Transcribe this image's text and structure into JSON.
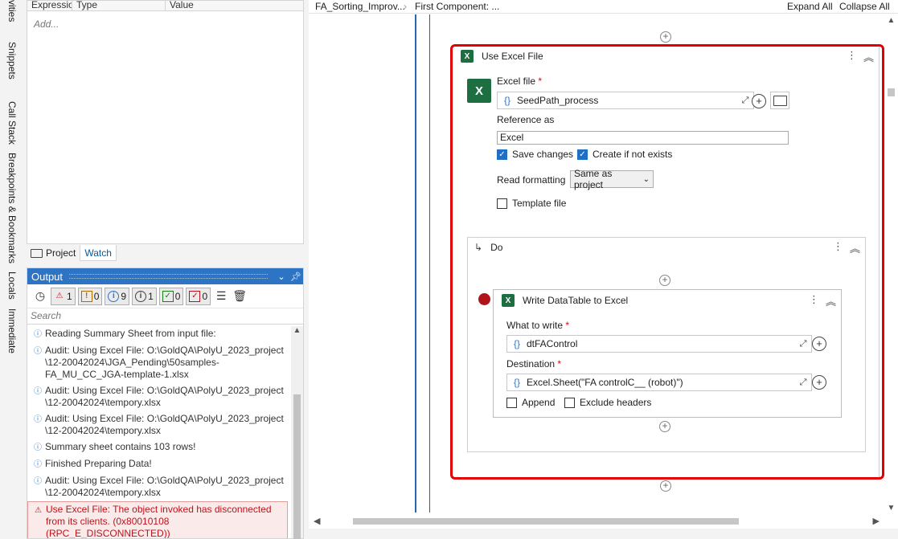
{
  "left_strip": {
    "tabs": [
      "Activities",
      "Snippets",
      "Call Stack",
      "Breakpoints & Bookmarks",
      "Locals",
      "Immediate"
    ]
  },
  "properties": {
    "columns": [
      "Expression",
      "Type",
      "Value"
    ],
    "add_placeholder": "Add..."
  },
  "panel_tabs": {
    "project": "Project",
    "watch": "Watch"
  },
  "output": {
    "title": "Output",
    "counts": {
      "errors": "1",
      "warnings": "0",
      "info": "9",
      "trace": "1",
      "success": "0",
      "verify": "0"
    },
    "search_placeholder": "Search",
    "logs": [
      {
        "text": "Reading Summary Sheet from input file:",
        "type": "info"
      },
      {
        "text": "Audit: Using Excel File: O:\\GoldQA\\PolyU_2023_project \\12-20042024\\JGA_Pending\\50samples-FA_MU_CC_JGA-template-1.xlsx",
        "type": "info"
      },
      {
        "text": "Audit: Using Excel File: O:\\GoldQA\\PolyU_2023_project \\12-20042024\\tempory.xlsx",
        "type": "info"
      },
      {
        "text": "Audit: Using Excel File: O:\\GoldQA\\PolyU_2023_project \\12-20042024\\tempory.xlsx",
        "type": "info"
      },
      {
        "text": "Summary sheet contains 103 rows!",
        "type": "info"
      },
      {
        "text": "Finished Preparing Data!",
        "type": "info"
      },
      {
        "text": "Audit: Using Excel File: O:\\GoldQA\\PolyU_2023_project \\12-20042024\\tempory.xlsx",
        "type": "info"
      },
      {
        "text": "Use Excel File: The object invoked has disconnected from its clients. (0x80010108 (RPC_E_DISCONNECTED))",
        "type": "error"
      }
    ]
  },
  "breadcrumb": {
    "items": [
      "FA_Sorting_Improv...",
      "First Component: ..."
    ],
    "expand_all": "Expand All",
    "collapse_all": "Collapse All"
  },
  "use_excel": {
    "title": "Use Excel File",
    "excel_file_label": "Excel file",
    "excel_file_value": "SeedPath_process",
    "reference_label": "Reference as",
    "reference_value": "Excel",
    "save_changes": "Save changes",
    "create_if_not_exists": "Create if not exists",
    "read_formatting_label": "Read formatting",
    "read_formatting_value": "Same as project",
    "template_file": "Template file",
    "do_label": "Do"
  },
  "write_dt": {
    "title": "Write DataTable to Excel",
    "what_label": "What to write",
    "what_value": "dtFAControl",
    "dest_label": "Destination",
    "dest_value": "Excel.Sheet(\"FA controlC__ (robot)\")",
    "append": "Append",
    "exclude_headers": "Exclude headers"
  },
  "colors": {
    "accent": "#2d74c4",
    "error": "#c0121b",
    "highlight": "#e20000",
    "excel": "#1d6f42"
  }
}
